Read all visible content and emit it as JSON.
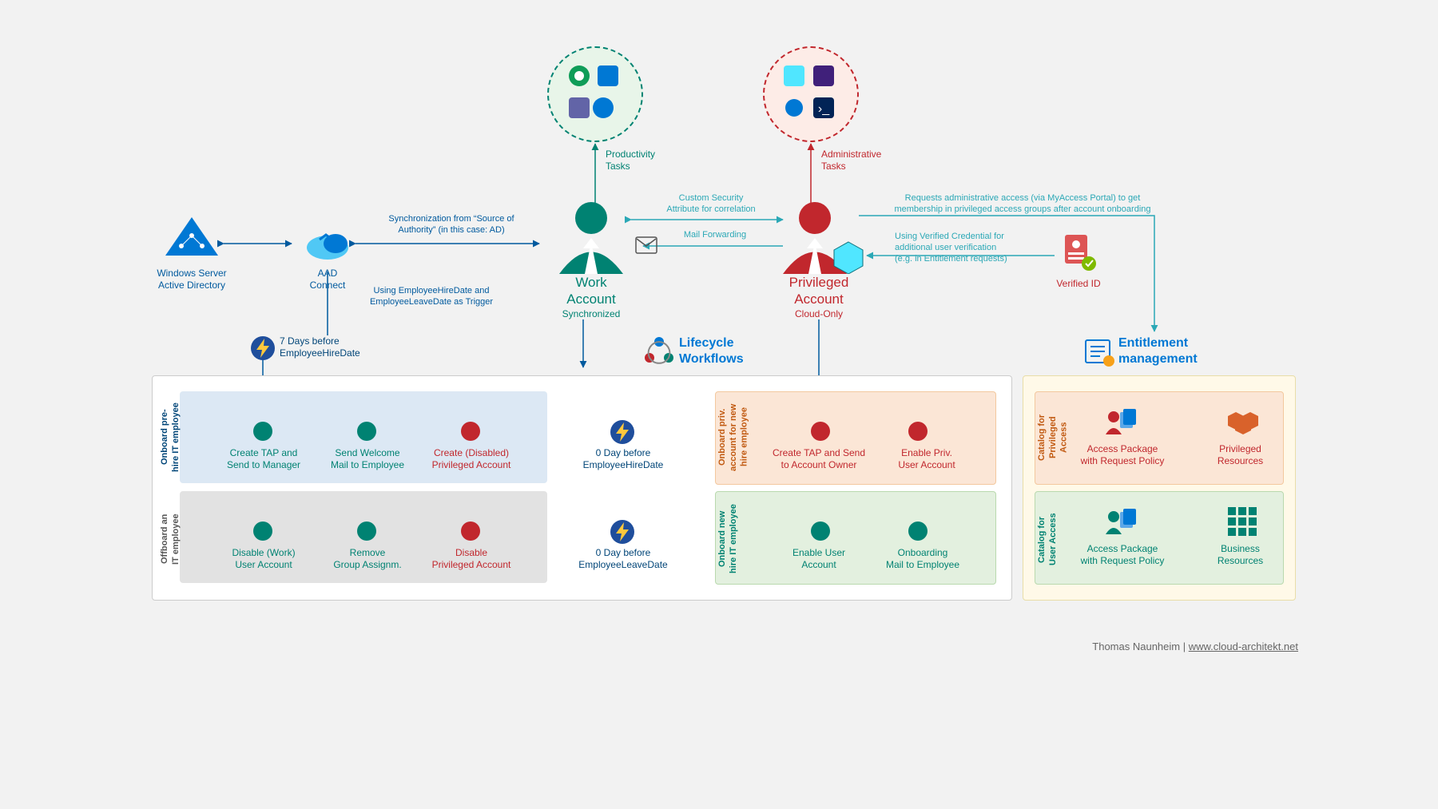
{
  "top": {
    "productivity_label": "Productivity\nTasks",
    "admin_label": "Administrative\nTasks",
    "custom_sec_attr": "Custom Security\nAttribute for correlation",
    "mail_fwd": "Mail Forwarding",
    "sync_label": "Synchronization from “Source of\nAuthority” (in this case: AD)",
    "requests_label": "Requests administrative access (via MyAccess Portal) to get\nmembership in privileged access groups after account onboarding",
    "verified_cred": "Using Verified Credential for\nadditional user verification\n(e.g. in Entitlement requests)"
  },
  "actors": {
    "ad": "Windows Server\nActive Directory",
    "aad": "AAD\nConnect",
    "work_title": "Work\nAccount",
    "work_sub": "Synchronized",
    "priv_title": "Privileged\nAccount",
    "priv_sub": "Cloud-Only",
    "verified_id": "Verified ID",
    "trigger_label": "Using EmployeeHireDate and\nEmployeeLeaveDate as Trigger",
    "timer1": "7 Days before\nEmployeeHireDate",
    "timer2": "0 Day before\nEmployeeHireDate",
    "timer3": "0 Day before\nEmployeeLeaveDate"
  },
  "sections": {
    "lifecycle_title": "Lifecycle\nWorkflows",
    "entitlement_title": "Entitlement\nmanagement",
    "row1_label": "Onboard pre-\nhire IT employee",
    "row1_a": "Create TAP and\nSend to Manager",
    "row1_b": "Send Welcome\nMail to Employee",
    "row1_c": "Create (Disabled)\nPrivileged Account",
    "row2_label": "Offboard an\nIT employee",
    "row2_a": "Disable (Work)\nUser Account",
    "row2_b": "Remove\nGroup Assignm.",
    "row2_c": "Disable\nPrivileged Account",
    "row3_label": "Onboard priv.\naccount for new\nhire employee",
    "row3_a": "Create TAP and Send\nto Account Owner",
    "row3_b": "Enable Priv.\nUser Account",
    "row4_label": "Onboard new\nhire IT employee",
    "row4_a": "Enable User\nAccount",
    "row4_b": "Onboarding\nMail to Employee",
    "cat1_label": "Catalog for\nPrivileged\nAccess",
    "cat1_a": "Access Package\nwith Request Policy",
    "cat1_b": "Privileged\nResources",
    "cat2_label": "Catalog for\nUser Access",
    "cat2_a": "Access Package\nwith Request Policy",
    "cat2_b": "Business\nResources"
  },
  "footer": {
    "author": "Thomas Naunheim | ",
    "site": "www.cloud-architekt.net"
  }
}
